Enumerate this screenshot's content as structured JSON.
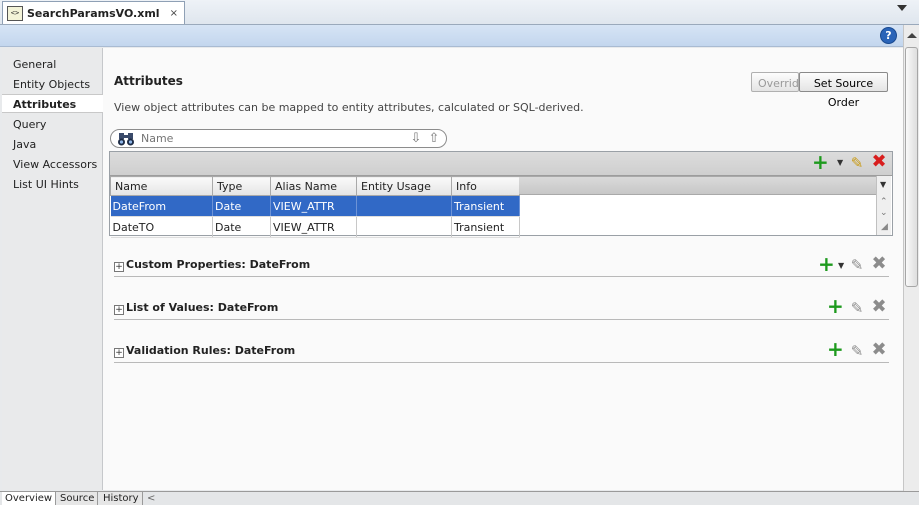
{
  "file_tab": {
    "name": "SearchParamsVO.xml",
    "close_glyph": "×"
  },
  "help_glyph": "?",
  "nav": {
    "items": [
      "General",
      "Entity Objects",
      "Attributes",
      "Query",
      "Java",
      "View Accessors",
      "List UI Hints"
    ],
    "selected": "Attributes"
  },
  "main": {
    "title": "Attributes",
    "description": "View object attributes can be mapped to entity attributes, calculated or SQL-derived.",
    "override_label": "Override",
    "set_source_order_label": "Set Source Order"
  },
  "search": {
    "placeholder": "Name",
    "value": ""
  },
  "table": {
    "columns": [
      "Name",
      "Type",
      "Alias Name",
      "Entity Usage",
      "Info"
    ],
    "rows": [
      [
        "DateFrom",
        "Date",
        "VIEW_ATTR",
        "",
        "Transient"
      ],
      [
        "DateTO",
        "Date",
        "VIEW_ATTR",
        "",
        "Transient"
      ]
    ],
    "selected_row": 0
  },
  "sections": [
    {
      "title": "Custom Properties: DateFrom",
      "expander": "+"
    },
    {
      "title": "List of Values: DateFrom",
      "expander": "+"
    },
    {
      "title": "Validation Rules: DateFrom",
      "expander": "+"
    }
  ],
  "bottom_tabs": [
    "Overview",
    "Source",
    "History"
  ],
  "bottom_tabs_selected": "Overview",
  "colors": {
    "selection": "#3169c6",
    "add_green": "#1e9a1e",
    "delete_red": "#d81e1e",
    "edit_gold": "#c89a14"
  },
  "icons": {
    "add": "plus-icon",
    "edit": "pencil-icon",
    "delete": "delete-icon",
    "search": "binoculars-icon",
    "help": "help-icon",
    "file": "xml-file-icon"
  }
}
